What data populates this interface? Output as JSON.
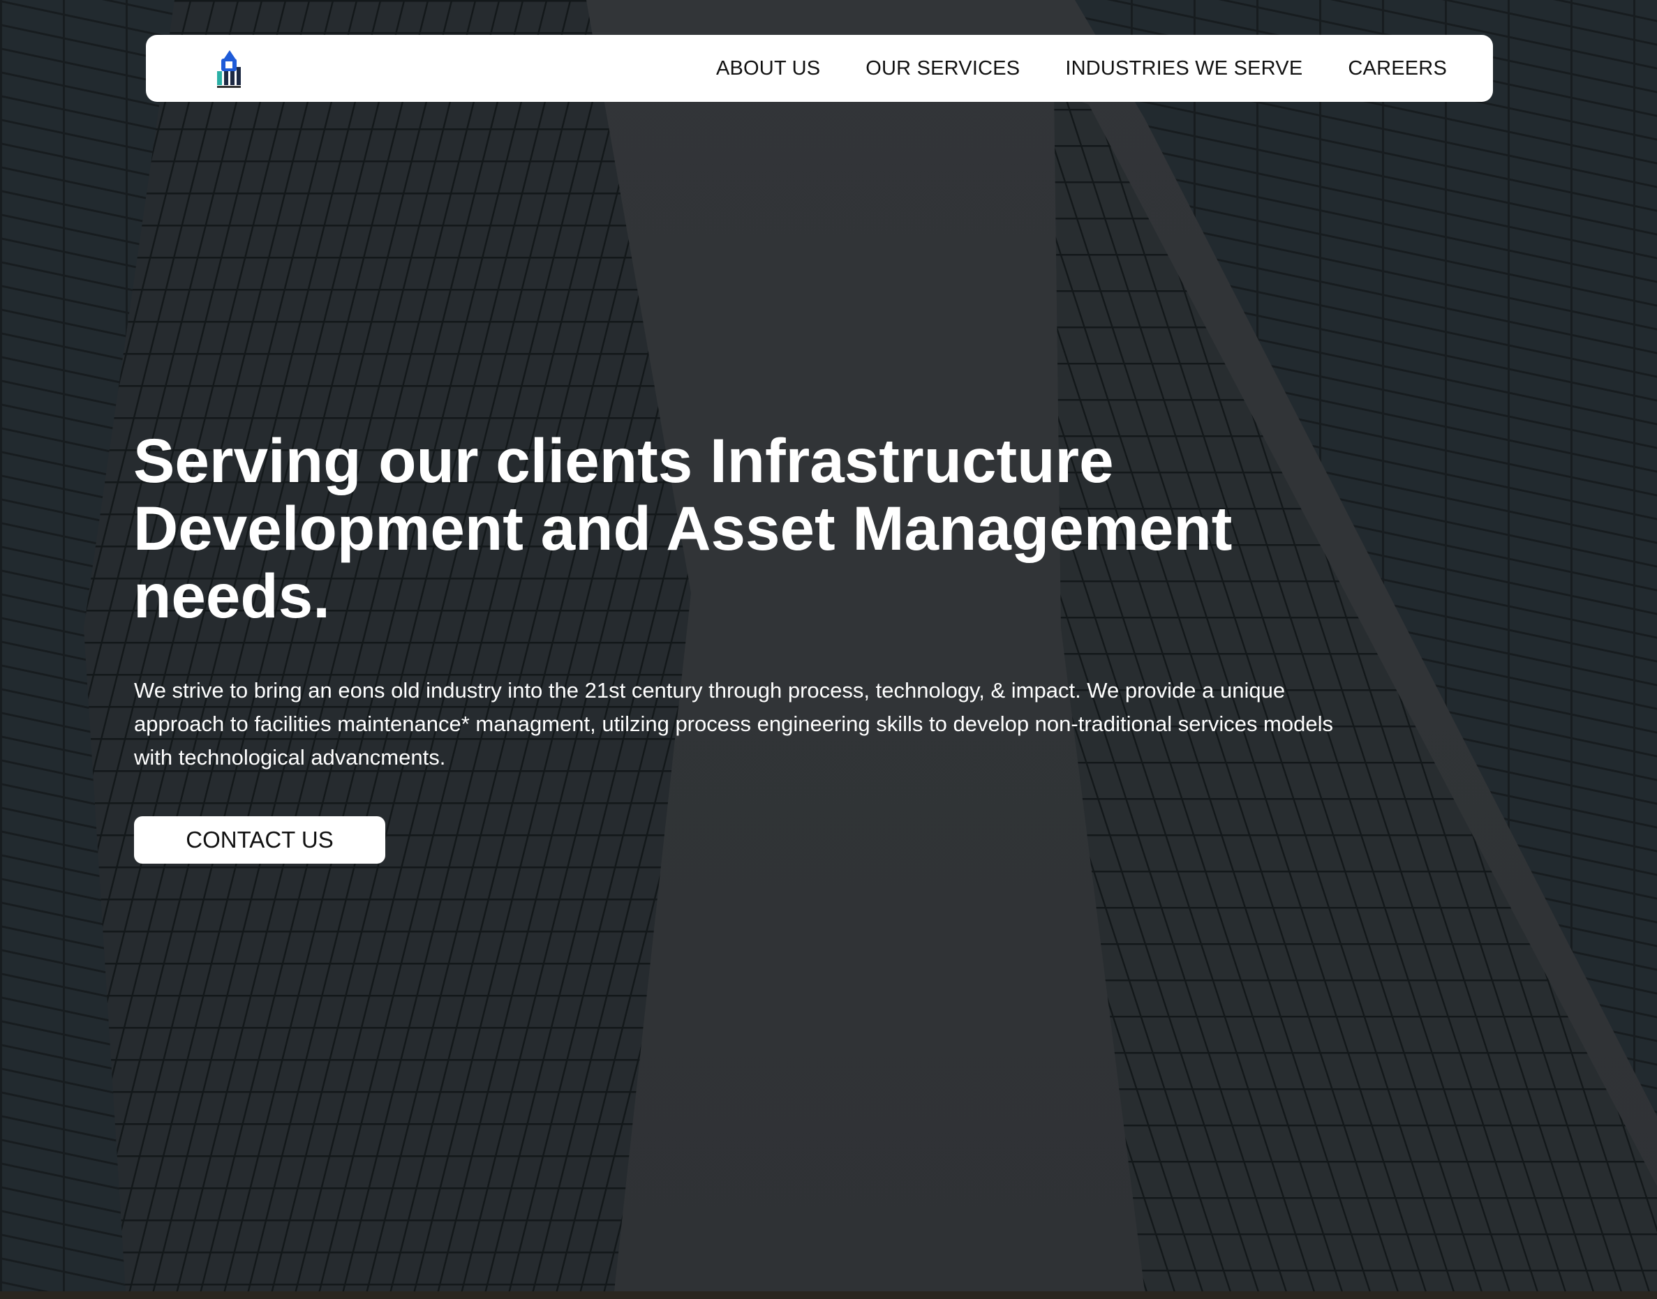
{
  "nav": {
    "logo_icon": "company-logo-icon",
    "links": [
      {
        "label": "ABOUT US"
      },
      {
        "label": "OUR SERVICES"
      },
      {
        "label": "INDUSTRIES WE SERVE"
      },
      {
        "label": "CAREERS"
      }
    ]
  },
  "hero": {
    "background_image": "skyscrapers-looking-up",
    "headline": "Serving our clients Infrastructure Development and Asset Management needs.",
    "description": "We strive to bring an eons old industry into the 21st century through process, technology, & impact. We provide a unique approach to facilities maintenance* managment, utilzing process engineering skills to develop non-traditional services models with technological advancments.",
    "cta_label": "CONTACT US"
  },
  "colors": {
    "overlay": "#3a3d40",
    "text_on_dark": "#ffffff",
    "nav_bg": "#ffffff",
    "nav_text": "#111111",
    "logo_blue": "#1e5bd8",
    "logo_teal": "#2bb0a6"
  }
}
